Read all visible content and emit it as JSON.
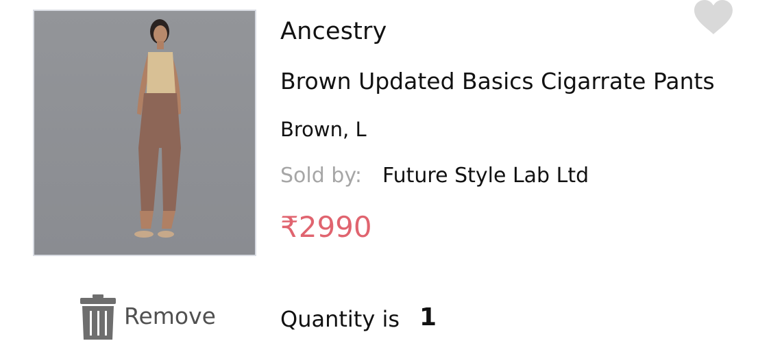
{
  "product": {
    "brand": "Ancestry",
    "title": "Brown Updated Basics Cigarrate Pants",
    "variant": "Brown, L",
    "sold_by_label": "Sold by:",
    "seller": "Future Style Lab Ltd",
    "price": "₹2990",
    "image_alt": "Model wearing brown cigarette pants"
  },
  "actions": {
    "remove_label": "Remove",
    "wishlist_icon": "heart-icon",
    "remove_icon": "trash-icon"
  },
  "quantity": {
    "label": "Quantity is",
    "value": "1"
  },
  "colors": {
    "price": "#e0646f",
    "muted": "#a6a6a6",
    "heart": "#d9d9d9",
    "trash": "#6e6e6e"
  }
}
